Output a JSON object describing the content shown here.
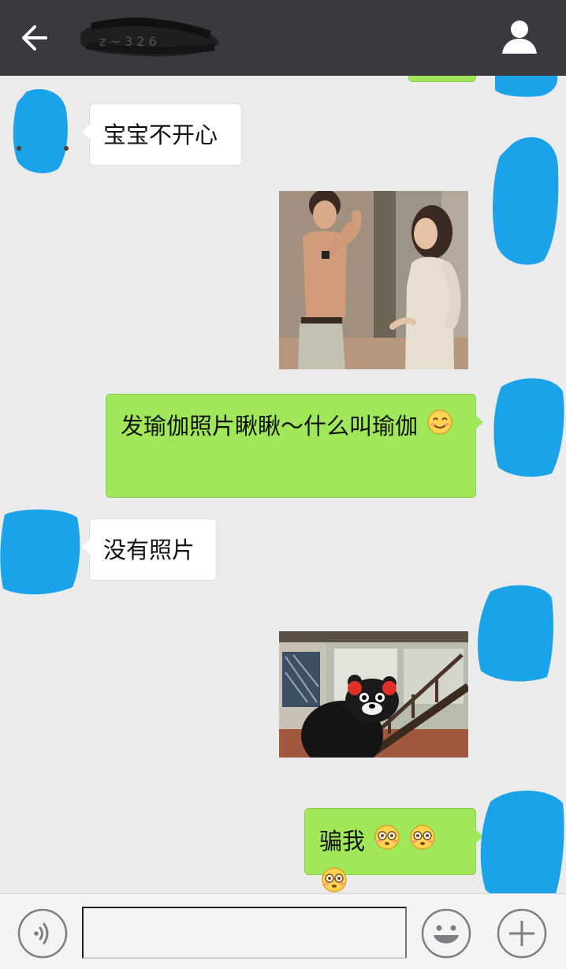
{
  "header": {
    "title": "",
    "back_icon": "arrow-left-icon",
    "contact_icon": "person-icon",
    "background": "#393a3f"
  },
  "colors": {
    "chat_background": "#ebebeb",
    "incoming_bubble": "#ffffff",
    "outgoing_bubble": "#a0e75a",
    "avatar_redaction": "#1aa3e8"
  },
  "messages": [
    {
      "side": "left",
      "type": "text",
      "text": "宝宝不开心"
    },
    {
      "side": "right",
      "type": "image",
      "description_icon": "photo-couple-icon"
    },
    {
      "side": "right",
      "type": "text",
      "text": "发瑜伽照片瞅瞅～什么叫瑜伽",
      "emojis": [
        "smile-emoji-icon"
      ]
    },
    {
      "side": "left",
      "type": "text",
      "text": "没有照片"
    },
    {
      "side": "right",
      "type": "image",
      "description_icon": "kumamon-sticker-icon"
    },
    {
      "side": "right",
      "type": "text",
      "text": "骗我",
      "emojis": [
        "dizzy-emoji-icon",
        "dizzy-emoji-icon",
        "dizzy-emoji-icon"
      ]
    }
  ],
  "input_bar": {
    "voice_icon": "voice-icon",
    "input_value": "",
    "emoji_icon": "emoji-icon",
    "plus_icon": "plus-icon"
  }
}
